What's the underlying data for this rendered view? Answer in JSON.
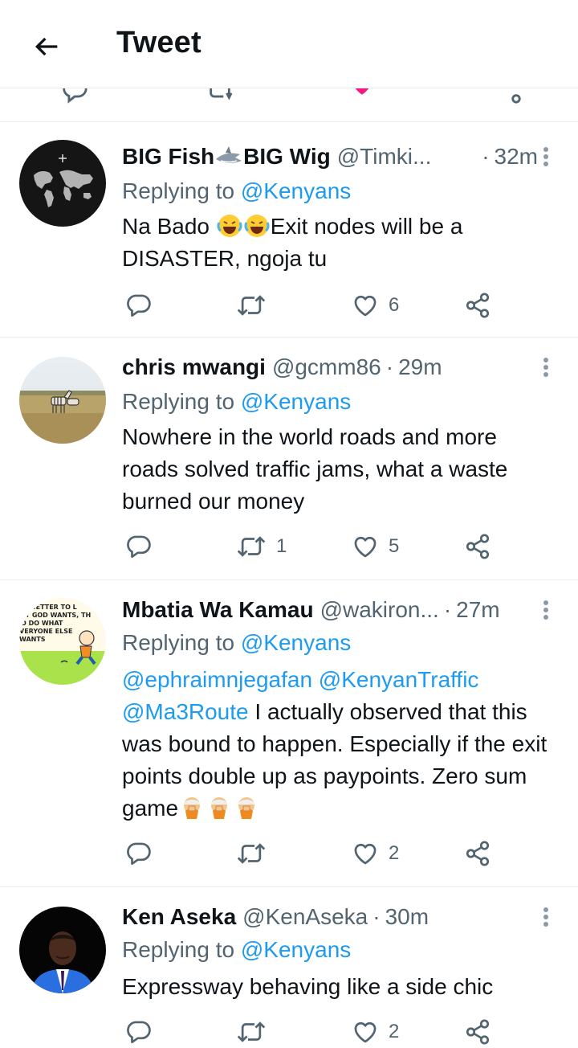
{
  "header": {
    "back_icon": "arrow-left-icon",
    "title": "Tweet"
  },
  "colors": {
    "accent": "#1d9bf0",
    "text": "#0f1419",
    "secondary": "#536471",
    "like_pink": "#f91880",
    "divider": "#e6ecf0"
  },
  "tweets": [
    {
      "name": "BIG Fish",
      "name_suffix": "BIG Wig",
      "handle": "@Timki...",
      "separator": "·",
      "time": "32m",
      "replying_prefix": "Replying to",
      "replying_to": "@Kenyans",
      "body_a": "Na Bado ",
      "body_b": "Exit nodes will be a DISASTER, ngoja tu",
      "replies": "",
      "retweets": "",
      "likes": "6"
    },
    {
      "name": "chris mwangi",
      "handle": "@gcmm86",
      "separator": "·",
      "time": "29m",
      "replying_prefix": "Replying to",
      "replying_to": "@Kenyans",
      "body": "Nowhere in the world roads and more roads solved traffic jams, what a waste burned our money",
      "replies": "",
      "retweets": "1",
      "likes": "5"
    },
    {
      "name": "Mbatia Wa Kamau",
      "handle": "@wakiron...",
      "separator": "·",
      "time": "27m",
      "replying_prefix": "Replying to",
      "replying_to": "@Kenyans",
      "mention_1": "@ephraimnjegafan",
      "mention_2": "@KenyanTraffic",
      "mention_3": "@Ma3Route",
      "body": " I actually observed that this was bound to happen. Especially if the exit points double up as paypoints. Zero sum game",
      "replies": "",
      "retweets": "",
      "likes": "2"
    },
    {
      "name": "Ken Aseka",
      "handle": "@KenAseka",
      "separator": "·",
      "time": "30m",
      "replying_prefix": "Replying to",
      "replying_to": "@Kenyans",
      "body": "Expressway behaving like a side chic",
      "replies": "",
      "retweets": "",
      "likes": "2"
    }
  ],
  "avatar_3_text": [
    "S BETTER TO L",
    "AT GOD WANTS, TH",
    "O DO WHAT",
    "VERYONE ELSE",
    "WANTS"
  ]
}
